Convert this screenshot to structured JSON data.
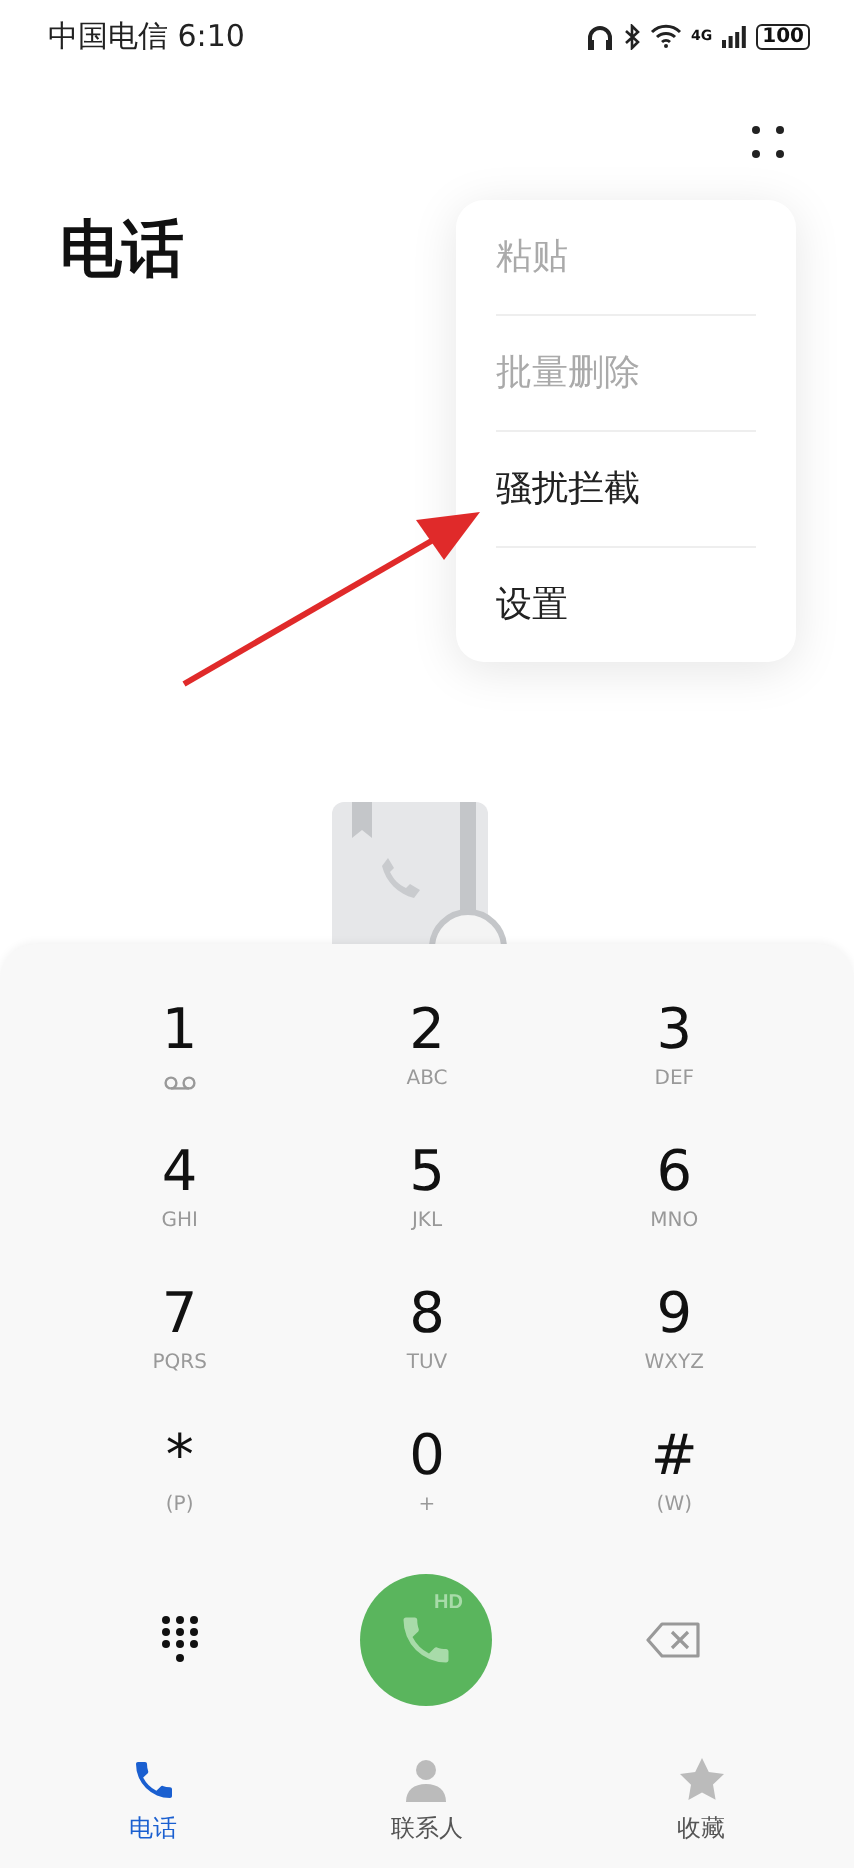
{
  "status_bar": {
    "carrier": "中国电信",
    "time": "6:10",
    "network": "4G",
    "battery": "100"
  },
  "title": "电话",
  "menu": {
    "items": [
      {
        "label": "粘贴",
        "disabled": true
      },
      {
        "label": "批量删除",
        "disabled": true
      },
      {
        "label": "骚扰拦截",
        "disabled": false
      },
      {
        "label": "设置",
        "disabled": false
      }
    ]
  },
  "keypad": {
    "keys": [
      {
        "digit": "1",
        "kind": "voicemail"
      },
      {
        "digit": "2",
        "letters": "ABC",
        "kind": "text"
      },
      {
        "digit": "3",
        "letters": "DEF",
        "kind": "text"
      },
      {
        "digit": "4",
        "letters": "GHI",
        "kind": "text"
      },
      {
        "digit": "5",
        "letters": "JKL",
        "kind": "text"
      },
      {
        "digit": "6",
        "letters": "MNO",
        "kind": "text"
      },
      {
        "digit": "7",
        "letters": "PQRS",
        "kind": "text"
      },
      {
        "digit": "8",
        "letters": "TUV",
        "kind": "text"
      },
      {
        "digit": "9",
        "letters": "WXYZ",
        "kind": "text"
      },
      {
        "digit": "*",
        "letters": "(P)",
        "kind": "text"
      },
      {
        "digit": "0",
        "letters": "+",
        "kind": "text"
      },
      {
        "digit": "#",
        "letters": "(W)",
        "kind": "text"
      }
    ],
    "call_badge": "HD"
  },
  "tabs": [
    {
      "label": "电话",
      "selected": true,
      "kind": "phone"
    },
    {
      "label": "联系人",
      "selected": false,
      "kind": "contacts"
    },
    {
      "label": "收藏",
      "selected": false,
      "kind": "star"
    }
  ]
}
